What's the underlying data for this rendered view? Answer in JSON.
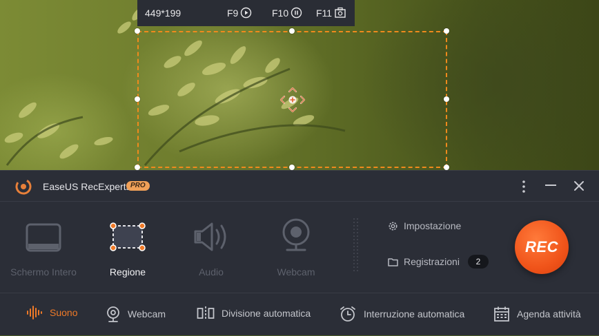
{
  "hotkey_bar": {
    "dimensions": "449*199",
    "start_key": "F9",
    "pause_key": "F10",
    "screenshot_key": "F11"
  },
  "app": {
    "title": "EaseUS RecExperts",
    "badge": "PRO"
  },
  "modes": [
    {
      "label": "Schermo Intero",
      "icon": "monitor-icon",
      "active": false
    },
    {
      "label": "Regione",
      "icon": "region-icon",
      "active": true
    },
    {
      "label": "Audio",
      "icon": "speaker-icon",
      "active": false
    },
    {
      "label": "Webcam",
      "icon": "webcam-icon",
      "active": false
    }
  ],
  "side_links": {
    "settings": "Impostazione",
    "recordings": "Registrazioni",
    "recordings_count": "2"
  },
  "rec_label": "REC",
  "bottom_options": [
    {
      "label": "Suono",
      "icon": "sound-wave-icon",
      "active": true
    },
    {
      "label": "Webcam",
      "icon": "webcam-small-icon",
      "active": false
    },
    {
      "label": "Divisione automatica",
      "icon": "split-icon",
      "active": false
    },
    {
      "label": "Interruzione automatica",
      "icon": "alarm-clock-icon",
      "active": false
    },
    {
      "label": "Agenda attività",
      "icon": "calendar-icon",
      "active": false
    }
  ],
  "colors": {
    "accent": "#f07a28",
    "rec": "#f0541a",
    "panel": "#2b2e37"
  }
}
